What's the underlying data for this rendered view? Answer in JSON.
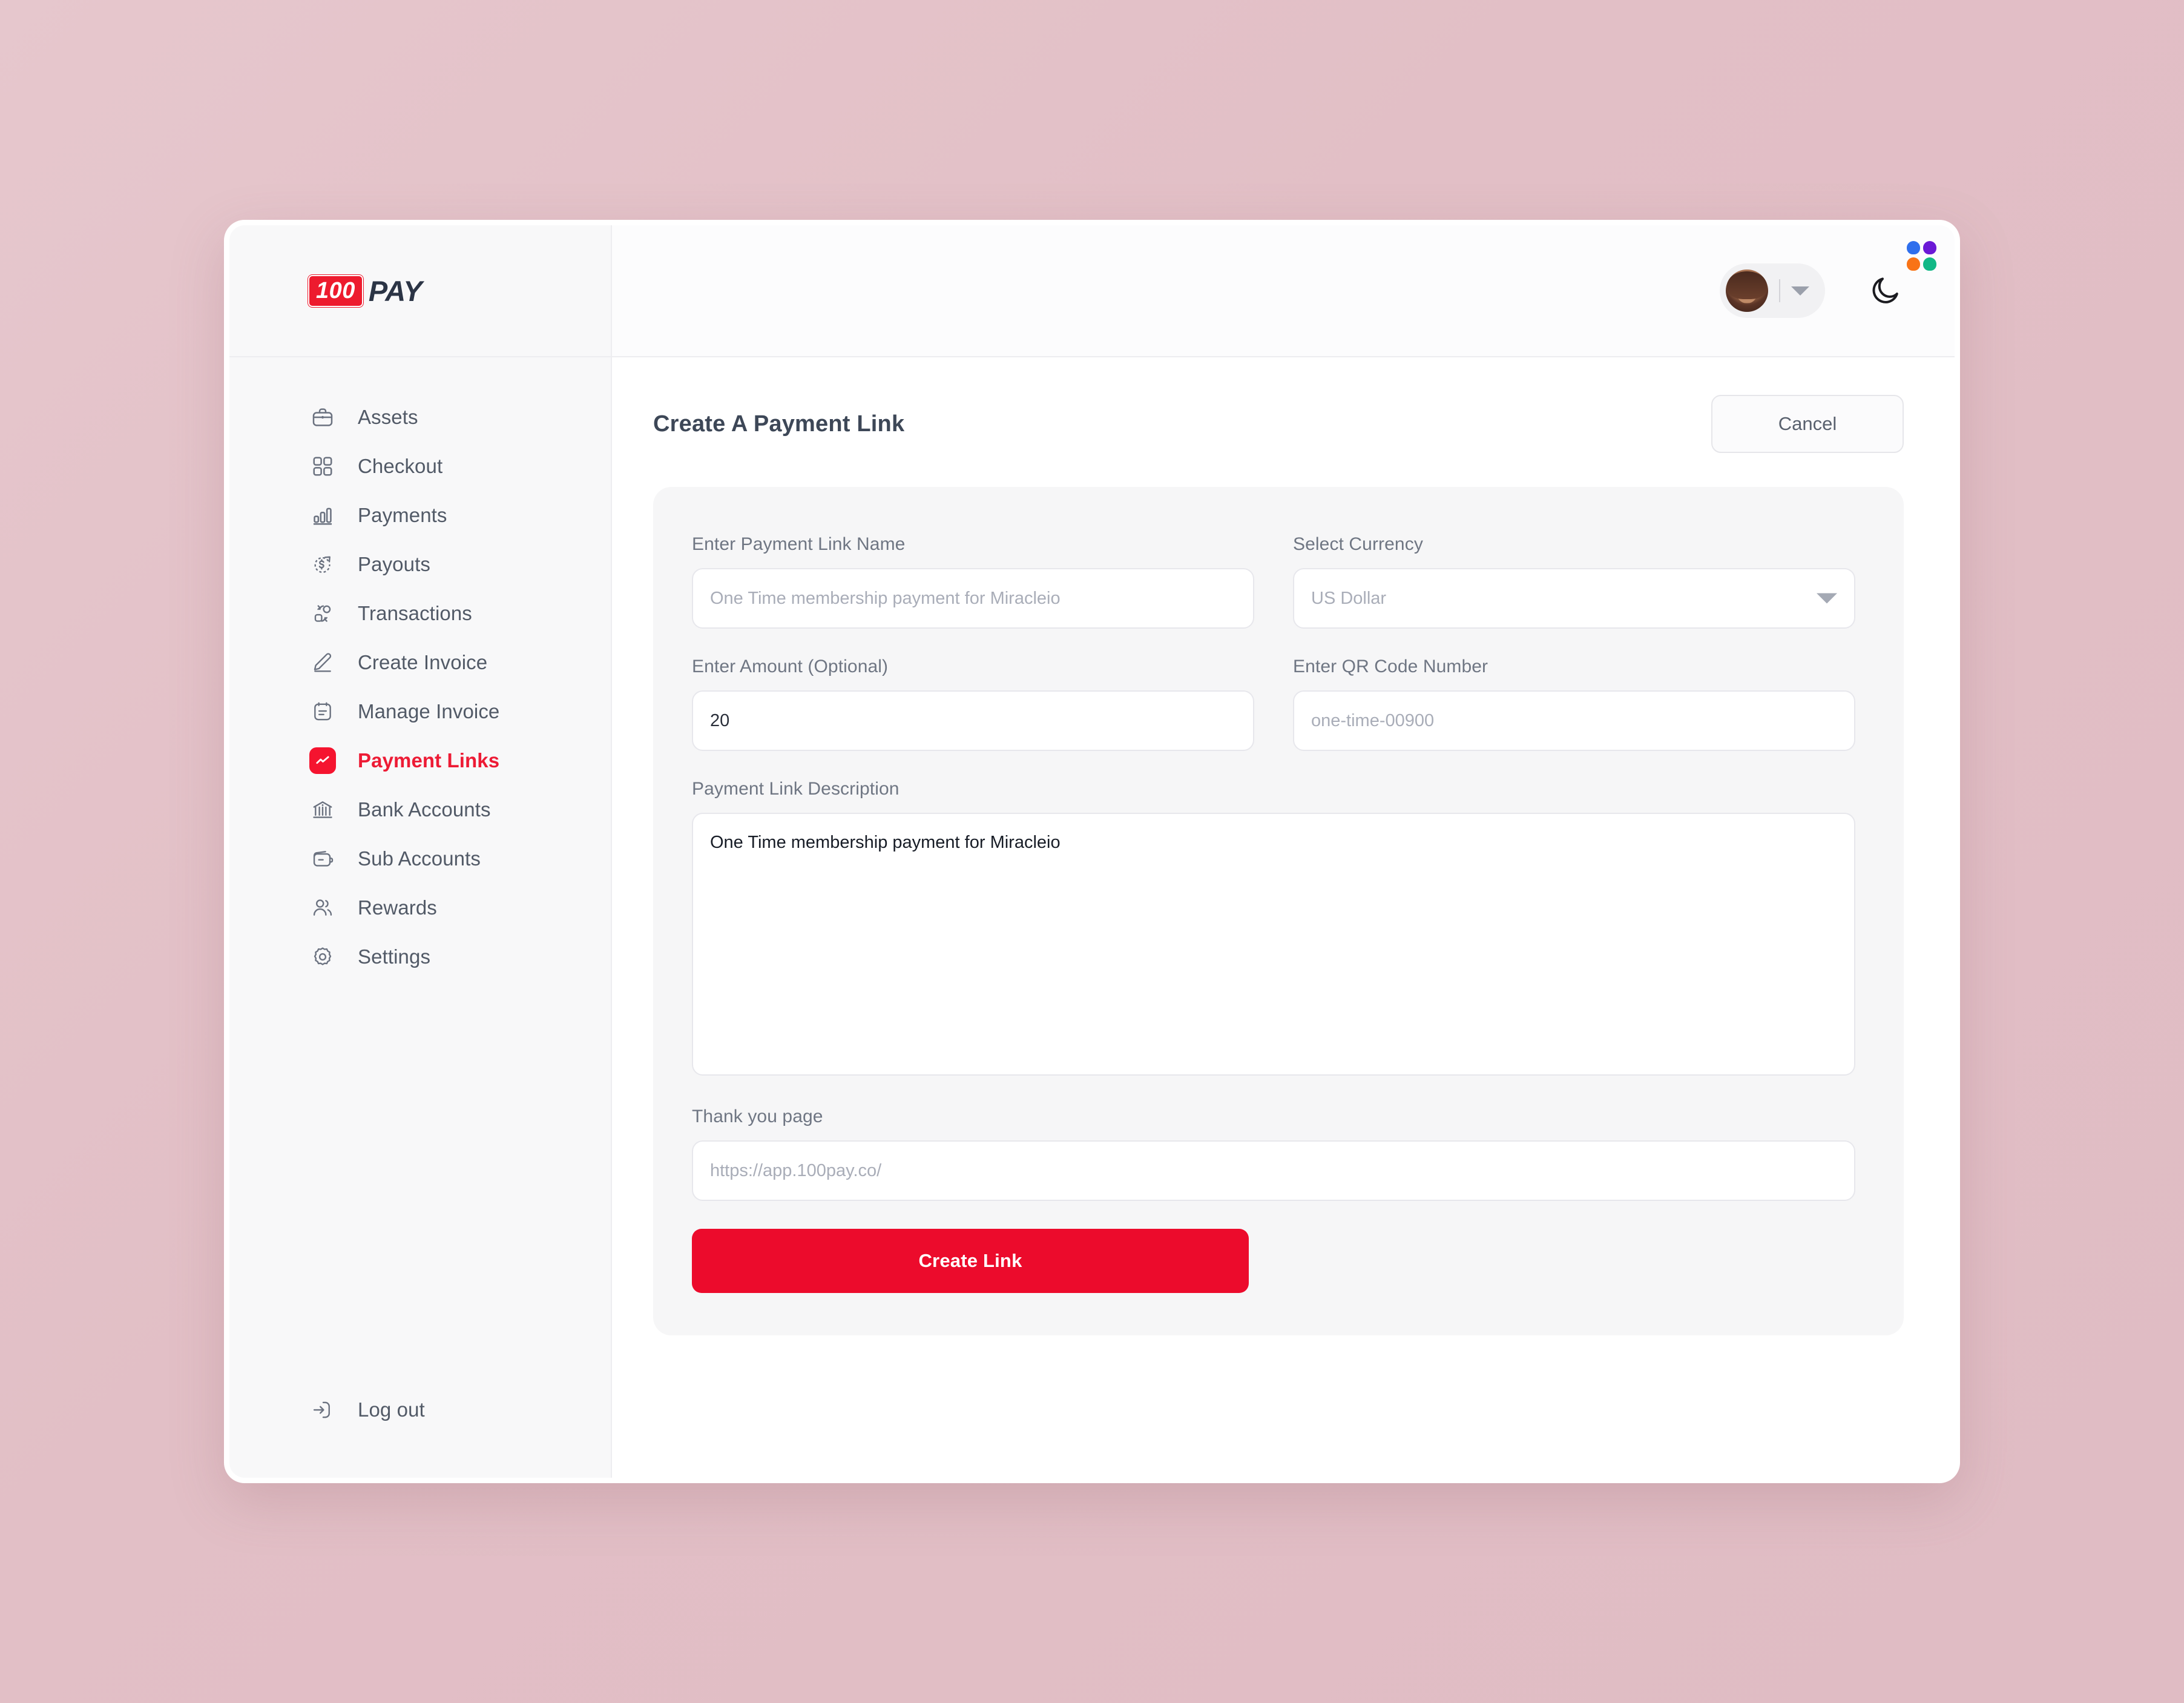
{
  "brand": {
    "badge_text": "100",
    "word": "PAY"
  },
  "header": {
    "avatar_name": "user-avatar",
    "theme_toggle_icon": "moon-icon",
    "cursor_badge_colors": [
      "#2f6fed",
      "#6b19d6",
      "#f97316",
      "#12b886"
    ]
  },
  "sidebar": {
    "items": [
      {
        "label": "Assets",
        "icon": "briefcase-icon",
        "active": false
      },
      {
        "label": "Checkout",
        "icon": "grid-icon",
        "active": false
      },
      {
        "label": "Payments",
        "icon": "bar-chart-icon",
        "active": false
      },
      {
        "label": "Payouts",
        "icon": "dollar-arrow-icon",
        "active": false
      },
      {
        "label": "Transactions",
        "icon": "transactions-icon",
        "active": false
      },
      {
        "label": "Create Invoice",
        "icon": "pencil-icon",
        "active": false
      },
      {
        "label": "Manage Invoice",
        "icon": "document-list-icon",
        "active": false
      },
      {
        "label": "Payment Links",
        "icon": "trend-line-icon",
        "active": true
      },
      {
        "label": "Bank Accounts",
        "icon": "bank-icon",
        "active": false
      },
      {
        "label": "Sub Accounts",
        "icon": "wallet-icon",
        "active": false
      },
      {
        "label": "Rewards",
        "icon": "users-icon",
        "active": false
      },
      {
        "label": "Settings",
        "icon": "gear-icon",
        "active": false
      }
    ],
    "logout": {
      "label": "Log out",
      "icon": "logout-icon"
    }
  },
  "main": {
    "page_title": "Create A Payment Link",
    "cancel_label": "Cancel",
    "form": {
      "link_name": {
        "label": "Enter Payment Link Name",
        "placeholder": "One Time membership payment for Miracleio",
        "value": ""
      },
      "currency": {
        "label": "Select Currency",
        "placeholder": "US Dollar",
        "value": "",
        "selected_option": "US Dollar"
      },
      "amount": {
        "label": "Enter Amount (Optional)",
        "placeholder": "",
        "value": "20"
      },
      "qr_code": {
        "label": "Enter QR Code Number",
        "placeholder": "one-time-00900",
        "value": ""
      },
      "description": {
        "label": "Payment Link Description",
        "placeholder": "",
        "value": "One Time membership payment for Miracleio"
      },
      "thank_you_page": {
        "label": "Thank you page",
        "placeholder": "https://app.100pay.co/",
        "value": ""
      },
      "submit_label": "Create Link"
    }
  },
  "colors": {
    "brand_red": "#ed1b2e",
    "cta_red": "#ec0b2c",
    "active_red": "#f5142f",
    "sidebar_bg": "#f8f8f9",
    "card_bg": "#f6f6f7",
    "desktop_bg": "#e3c2c8"
  }
}
